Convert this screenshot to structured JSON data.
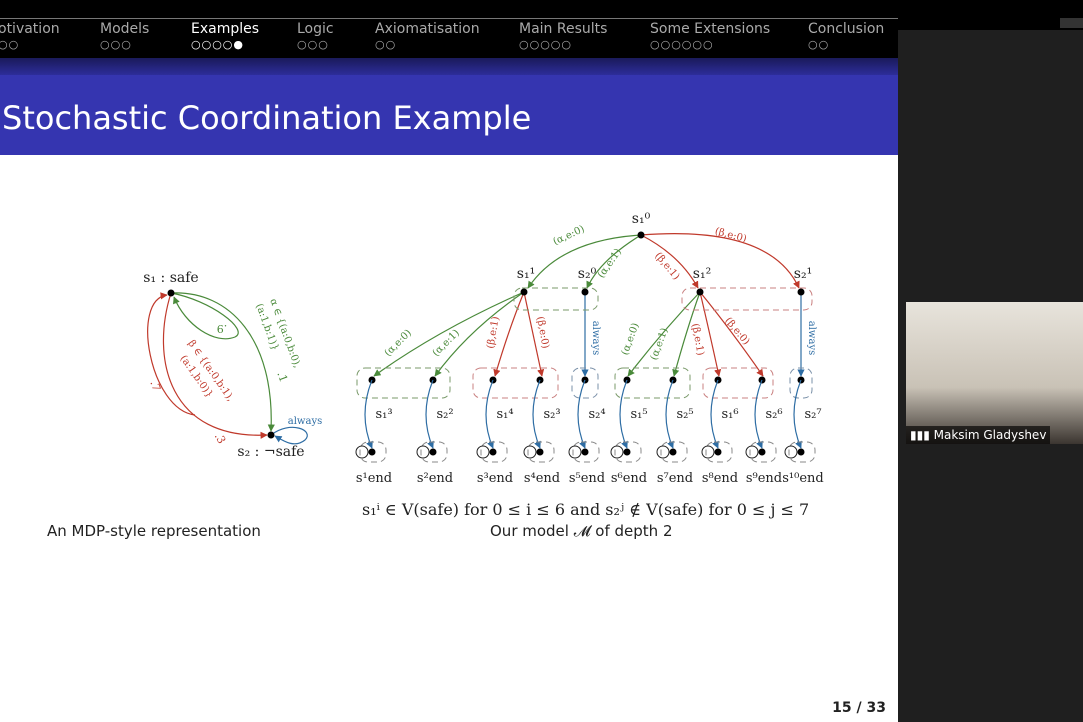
{
  "nav": {
    "sections": [
      {
        "label": "otivation",
        "dots": "○○",
        "active": false
      },
      {
        "label": "Models",
        "dots": "○○○",
        "active": false
      },
      {
        "label": "Examples",
        "dots": "○○○○●",
        "active": true
      },
      {
        "label": "Logic",
        "dots": "○○○",
        "active": false
      },
      {
        "label": "Axiomatisation",
        "dots": "○○",
        "active": false
      },
      {
        "label": "Main Results",
        "dots": "○○○○○",
        "active": false
      },
      {
        "label": "Some Extensions",
        "dots": "○○○○○○",
        "active": false
      },
      {
        "label": "Conclusion",
        "dots": "○○",
        "active": false
      }
    ]
  },
  "slide": {
    "title": "Stochastic Coordination Example",
    "page": "15 / 33",
    "colors": {
      "alpha": "#4a8a3a",
      "beta": "#c0392b",
      "always": "#2e6da4",
      "title_bar": "#3535b0"
    },
    "left": {
      "s1": "s₁ : safe",
      "s2": "s₂ : ¬safe",
      "alpha_label": "α ∈ {(a:0,b:0),",
      "alpha_label2": "(a:1,b:1)}",
      "beta_label": "β ∈ {(a:0,b:1),",
      "beta_label2": "(a:1,b:0)}",
      "p9": ".9",
      "p1": ".1",
      "p7": ".7",
      "p3": ".3",
      "always": "always",
      "caption": "An MDP-style representation"
    },
    "right": {
      "root": "s₁⁰",
      "level1": [
        "s₁¹",
        "s₂⁰",
        "s₁²",
        "s₂¹"
      ],
      "root_edges": [
        "(α,e:0)",
        "(α,e:1)",
        "(β,e:1)",
        "(β,e:0)"
      ],
      "child_edges": [
        "(α,e:0)",
        "(α,e:1)",
        "(β,e:1)",
        "(β,e:0)"
      ],
      "always": "always",
      "level2": [
        "s₁³",
        "s₂²",
        "s₁⁴",
        "s₂³",
        "s₂⁴",
        "s₁⁵",
        "s₂⁵",
        "s₁⁶",
        "s₂⁶",
        "s₂⁷"
      ],
      "ends": [
        "s¹end",
        "s²end",
        "s³end",
        "s⁴end",
        "s⁵end",
        "s⁶end",
        "s⁷end",
        "s⁸end",
        "s⁹end",
        "s¹⁰end"
      ],
      "caption1": "s₁ⁱ ∈ V(safe) for 0 ≤ i ≤ 6 and s₂ʲ ∉ V(safe) for 0 ≤ j ≤ 7",
      "caption2": "Our model 𝓜 of depth 2"
    }
  },
  "video": {
    "participant": "Maksim Gladyshev"
  }
}
